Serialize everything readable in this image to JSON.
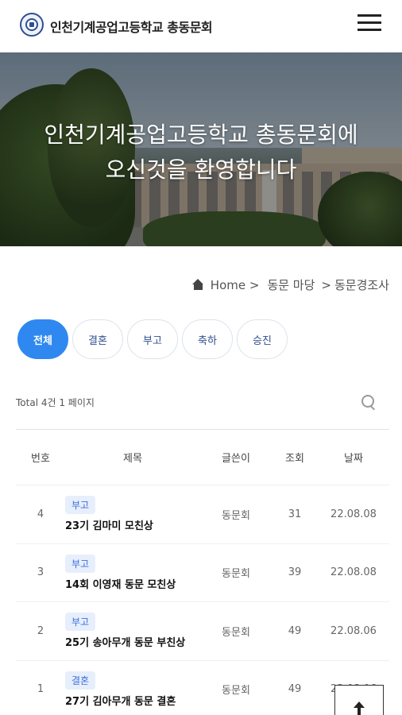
{
  "header": {
    "site_title": "인천기계공업고등학교 총동문회",
    "logo_icon": "school-emblem-icon",
    "menu_icon": "hamburger-menu-icon"
  },
  "hero": {
    "caption_line1": "인천기계공업고등학교 총동문회에",
    "caption_line2": "오신것을 환영합니다"
  },
  "breadcrumb": {
    "home": "Home >",
    "section": "동문 마당",
    "sep": ">",
    "current": "동문경조사"
  },
  "tabs": [
    {
      "label": "전체",
      "active": true
    },
    {
      "label": "결혼",
      "active": false
    },
    {
      "label": "부고",
      "active": false
    },
    {
      "label": "축하",
      "active": false
    },
    {
      "label": "승진",
      "active": false
    }
  ],
  "summary": {
    "total_text": "Total 4건 1 페이지"
  },
  "table": {
    "headers": {
      "no": "번호",
      "title": "제목",
      "writer": "글쓴이",
      "views": "조회",
      "date": "날짜"
    },
    "rows": [
      {
        "no": "4",
        "category": "부고",
        "title": "23기 김마미 모친상",
        "writer": "동문회",
        "views": "31",
        "date": "22.08.08"
      },
      {
        "no": "3",
        "category": "부고",
        "title": "14회 이영재 동문 모친상",
        "writer": "동문회",
        "views": "39",
        "date": "22.08.08"
      },
      {
        "no": "2",
        "category": "부고",
        "title": "25기 송아무개 동문 부친상",
        "writer": "동문회",
        "views": "49",
        "date": "22.08.06"
      },
      {
        "no": "1",
        "category": "결혼",
        "title": "27기 김아무개 동문 결혼",
        "writer": "동문회",
        "views": "49",
        "date": "22.08.06"
      }
    ]
  },
  "colors": {
    "accent": "#2f88f0",
    "badge_bg": "#e7eefc",
    "badge_text": "#3a6fd8"
  }
}
